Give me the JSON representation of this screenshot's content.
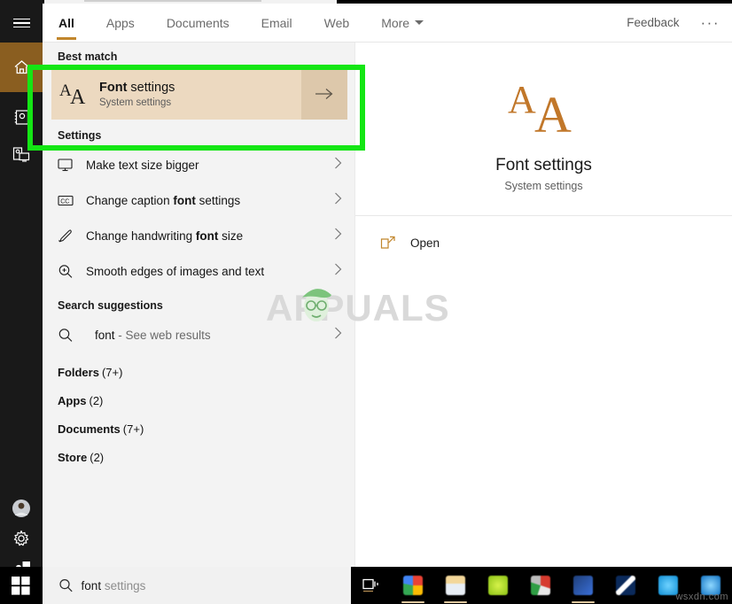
{
  "window": {
    "title": "Windows Search",
    "accent_orange": "#c1862c",
    "highlight_tan": "#ecd9c0",
    "annotation_green": "#14e614"
  },
  "header": {
    "hamburger_icon": "hamburger-icon",
    "tabs": [
      {
        "label": "All",
        "active": true
      },
      {
        "label": "Apps",
        "active": false
      },
      {
        "label": "Documents",
        "active": false
      },
      {
        "label": "Email",
        "active": false
      },
      {
        "label": "Web",
        "active": false
      },
      {
        "label": "More",
        "active": false,
        "has_caret": true
      }
    ],
    "feedback_label": "Feedback",
    "overflow_label": "···"
  },
  "rail": {
    "items": [
      {
        "name": "home",
        "icon": "home-icon",
        "active": true
      },
      {
        "name": "documents",
        "icon": "documents-icon",
        "active": false
      },
      {
        "name": "pictures-device",
        "icon": "device-screen-icon",
        "active": false
      }
    ],
    "bottom_items": [
      {
        "name": "account",
        "icon": "account-avatar-icon"
      },
      {
        "name": "settings",
        "icon": "gear-icon"
      },
      {
        "name": "power-user",
        "icon": "person-chat-icon"
      },
      {
        "name": "start",
        "icon": "windows-logo-icon"
      }
    ]
  },
  "results": {
    "best_match_header": "Best match",
    "best_match": {
      "title_bold": "Font",
      "title_rest": " settings",
      "subtitle": "System settings",
      "icon": "font-aa-icon",
      "arrow_icon": "arrow-right-icon"
    },
    "settings_header": "Settings",
    "settings_items": [
      {
        "icon": "monitor-icon",
        "pre": "Make text size bigger",
        "bold": "",
        "post": "",
        "chevron": "chevron-right-icon"
      },
      {
        "icon": "closed-caption-icon",
        "pre": "Change caption ",
        "bold": "font",
        "post": " settings",
        "chevron": "chevron-right-icon"
      },
      {
        "icon": "pen-icon",
        "pre": "Change handwriting ",
        "bold": "font",
        "post": " size",
        "chevron": "chevron-right-icon"
      },
      {
        "icon": "magnifier-plus-icon",
        "pre": "Smooth edges of images and text",
        "bold": "",
        "post": "",
        "chevron": "chevron-right-icon"
      }
    ],
    "suggestions_header": "Search suggestions",
    "suggestion": {
      "icon": "search-icon",
      "query": "font",
      "hint": " - See web results",
      "chevron": "chevron-right-icon"
    },
    "categories": [
      {
        "label": "Folders",
        "count": "(7+)"
      },
      {
        "label": "Apps",
        "count": "(2)"
      },
      {
        "label": "Documents",
        "count": "(7+)"
      },
      {
        "label": "Store",
        "count": "(2)"
      }
    ]
  },
  "preview": {
    "icon": "font-aa-icon",
    "title": "Font settings",
    "subtitle": "System settings",
    "action": {
      "icon": "open-external-icon",
      "label": "Open"
    }
  },
  "watermark": {
    "text": "APPUALS",
    "taskbar_text": "wsxdn.com"
  },
  "taskbar": {
    "start_icon": "windows-logo-icon",
    "search": {
      "icon": "search-icon",
      "typed": "font",
      "suggested": " settings"
    },
    "taskview_icon": "task-view-icon",
    "apps": [
      {
        "name": "chrome",
        "icon": "chrome-icon",
        "running": true
      },
      {
        "name": "file-explorer",
        "icon": "folder-icon",
        "running": true
      },
      {
        "name": "green-app",
        "icon": "green-circle-icon",
        "running": false
      },
      {
        "name": "office-app",
        "icon": "multicolor-app-icon",
        "running": false
      },
      {
        "name": "blue-app",
        "icon": "blue-tile-icon",
        "running": true
      },
      {
        "name": "ribbon-app",
        "icon": "ribbon-icon",
        "running": false
      },
      {
        "name": "cyan-app",
        "icon": "cyan-circle-icon",
        "running": false
      },
      {
        "name": "cyan-app-2",
        "icon": "cyan-tile-icon",
        "running": false
      }
    ]
  }
}
